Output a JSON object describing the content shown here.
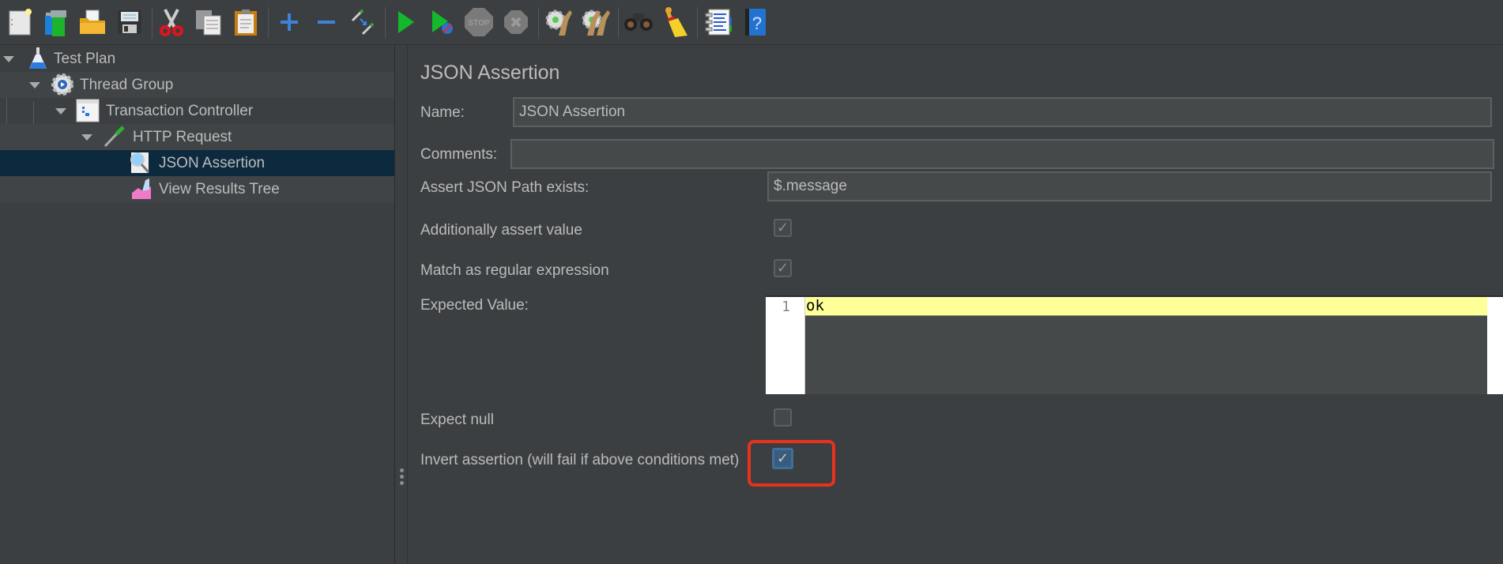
{
  "toolbar": {
    "buttons": [
      {
        "name": "new-icon",
        "label": "New"
      },
      {
        "name": "templates-icon",
        "label": "Templates"
      },
      {
        "name": "open-icon",
        "label": "Open"
      },
      {
        "name": "save-icon",
        "label": "Save"
      },
      {
        "name": "cut-icon",
        "label": "Cut"
      },
      {
        "name": "copy-icon",
        "label": "Copy"
      },
      {
        "name": "paste-icon",
        "label": "Paste"
      },
      {
        "name": "expand-all-icon",
        "label": "Expand"
      },
      {
        "name": "collapse-all-icon",
        "label": "Collapse"
      },
      {
        "name": "toggle-icon",
        "label": "Toggle"
      },
      {
        "name": "start-icon",
        "label": "Start"
      },
      {
        "name": "start-no-pauses-icon",
        "label": "Start no pauses"
      },
      {
        "name": "stop-icon",
        "label": "STOP"
      },
      {
        "name": "shutdown-icon",
        "label": "Shutdown"
      },
      {
        "name": "clear-icon",
        "label": "Clear"
      },
      {
        "name": "clear-all-icon",
        "label": "Clear All"
      },
      {
        "name": "search-icon",
        "label": "Search"
      },
      {
        "name": "reset-search-icon",
        "label": "Reset Search"
      },
      {
        "name": "function-helper-icon",
        "label": "Function Helper"
      },
      {
        "name": "help-icon",
        "label": "?"
      }
    ]
  },
  "tree": {
    "items": [
      {
        "label": "Test Plan",
        "icon": "flask-icon",
        "level": 0,
        "expanded": true
      },
      {
        "label": "Thread Group",
        "icon": "gear-icon",
        "level": 1,
        "expanded": true
      },
      {
        "label": "Transaction Controller",
        "icon": "controller-icon",
        "level": 2,
        "expanded": true
      },
      {
        "label": "HTTP Request",
        "icon": "pipette-icon",
        "level": 3,
        "expanded": true
      },
      {
        "label": "JSON Assertion",
        "icon": "magnifier-icon",
        "level": 4,
        "selected": true
      },
      {
        "label": "View Results Tree",
        "icon": "graph-icon",
        "level": 4
      }
    ]
  },
  "form": {
    "title": "JSON Assertion",
    "name_label": "Name:",
    "name_value": "JSON Assertion",
    "comments_label": "Comments:",
    "comments_value": "",
    "json_path_label": "Assert JSON Path exists:",
    "json_path_value": "$.message",
    "additionally_assert_label": "Additionally assert value",
    "additionally_assert_checked": true,
    "match_regex_label": "Match as regular expression",
    "match_regex_checked": true,
    "expected_value_label": "Expected Value:",
    "expected_value_line_number": "1",
    "expected_value": "ok",
    "expect_null_label": "Expect null",
    "expect_null_checked": false,
    "invert_label": "Invert assertion (will fail if above conditions met)",
    "invert_checked": true
  },
  "colors": {
    "background": "#3c3f41",
    "selection": "#0d293e",
    "highlight": "#e8321c",
    "editor_current_line": "#ffff9a"
  },
  "check_glyph": "✓"
}
